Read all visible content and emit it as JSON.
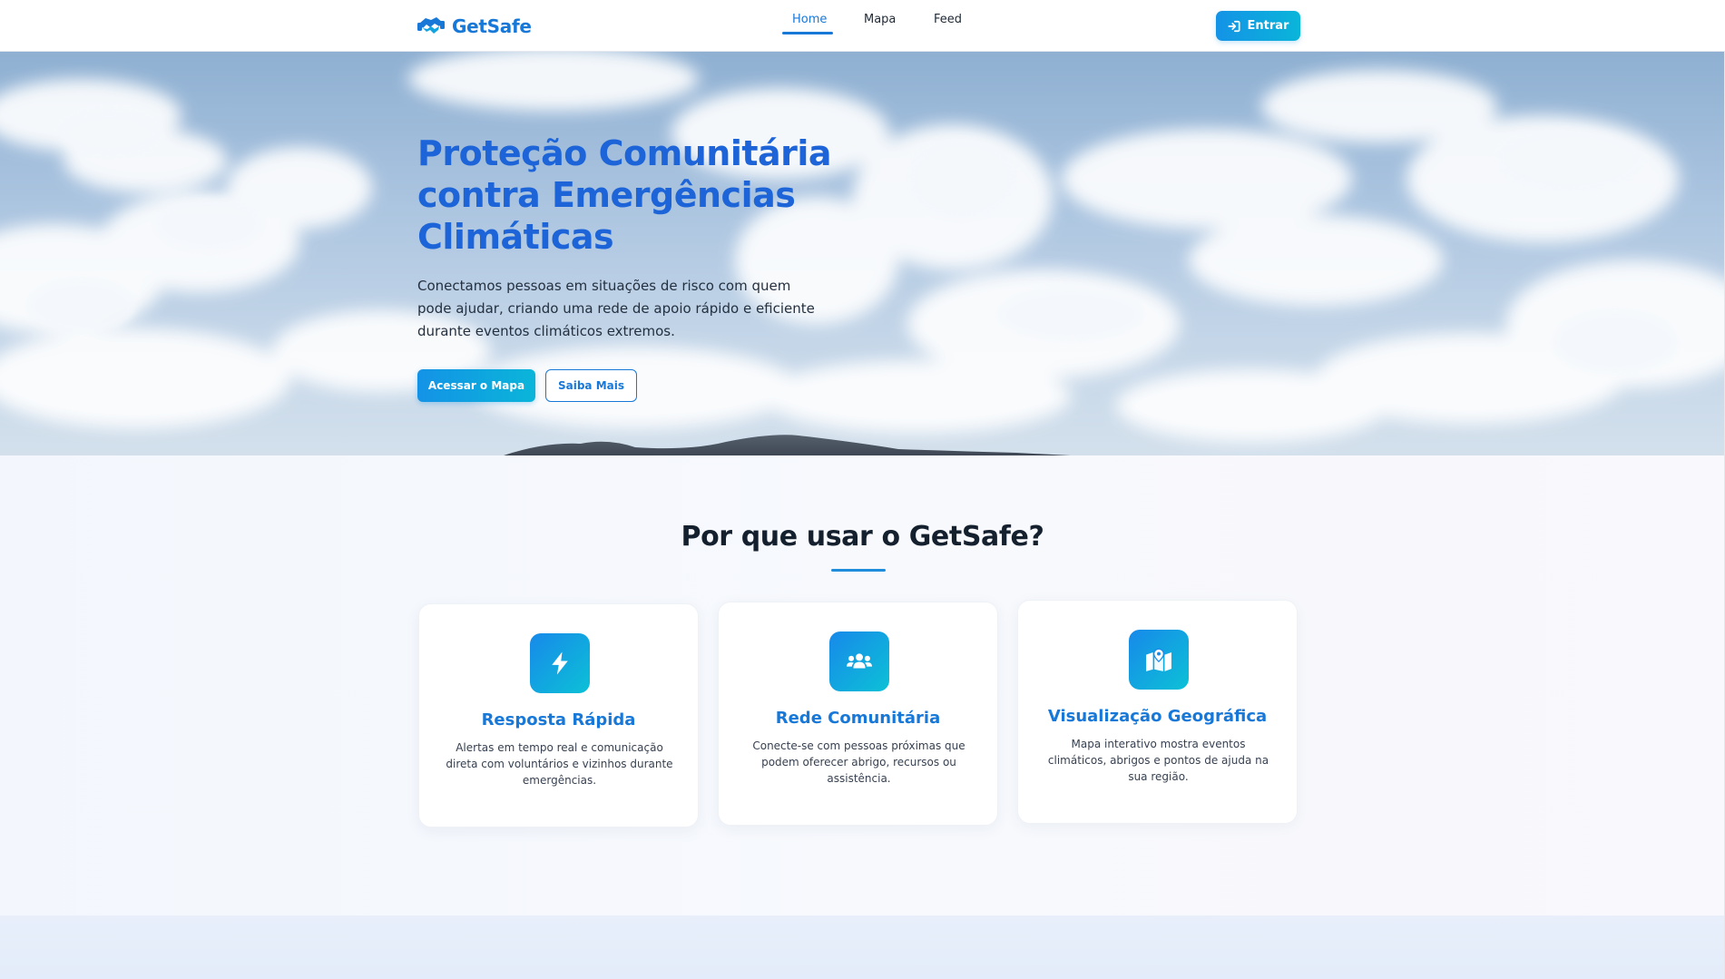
{
  "brand": {
    "name": "GetSafe"
  },
  "nav": {
    "items": [
      {
        "label": "Home",
        "active": true
      },
      {
        "label": "Mapa",
        "active": false
      },
      {
        "label": "Feed",
        "active": false
      }
    ],
    "login_label": "Entrar",
    "login_icon": "sign-in-icon"
  },
  "hero": {
    "title": "Proteção Comunitária contra Emergências Climáticas",
    "description": "Conectamos pessoas em situações de risco com quem pode ajudar, criando uma rede de apoio rápido e eficiente durante eventos climáticos extremos.",
    "primary_button": "Acessar o Mapa",
    "secondary_button": "Saiba Mais"
  },
  "features": {
    "title": "Por que usar o GetSafe?",
    "cards": [
      {
        "icon": "lightning-bolt-icon",
        "title": "Resposta Rápida",
        "text": "Alertas em tempo real e comunicação direta com voluntários e vizinhos durante emergências."
      },
      {
        "icon": "users-group-icon",
        "title": "Rede Comunitária",
        "text": "Conecte-se com pessoas próximas que podem oferecer abrigo, recursos ou assistência."
      },
      {
        "icon": "map-location-icon",
        "title": "Visualização Geográfica",
        "text": "Mapa interativo mostra eventos climáticos, abrigos e pontos de ajuda na sua região."
      }
    ]
  },
  "colors": {
    "brand_blue": "#1878d8",
    "hero_title": "#1c64d8",
    "gradient_start": "#1493e6",
    "gradient_end": "#0ab5d9"
  }
}
